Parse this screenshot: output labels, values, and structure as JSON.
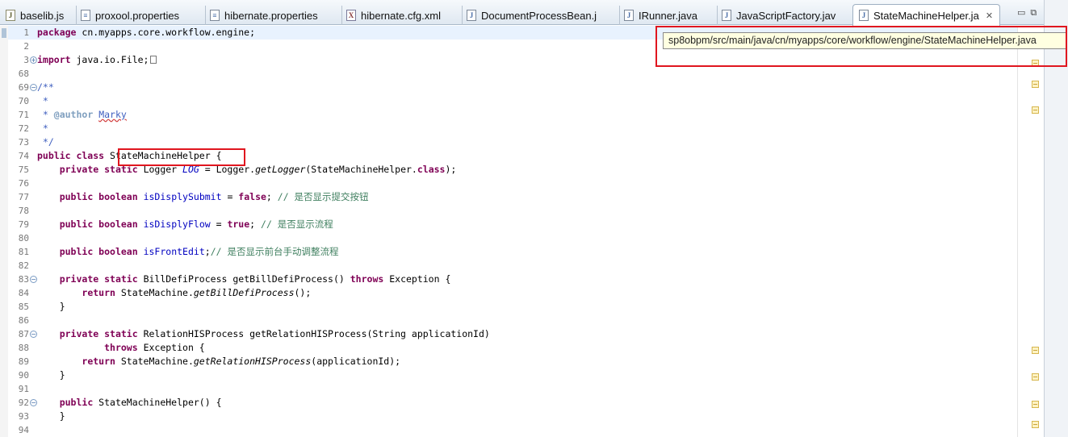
{
  "tabs": [
    {
      "label": "baselib.js",
      "icon": "js-file-icon"
    },
    {
      "label": "proxool.properties",
      "icon": "properties-file-icon"
    },
    {
      "label": "hibernate.properties",
      "icon": "properties-file-icon"
    },
    {
      "label": "hibernate.cfg.xml",
      "icon": "xml-file-icon"
    },
    {
      "label": "DocumentProcessBean.j",
      "icon": "java-file-icon"
    },
    {
      "label": "IRunner.java",
      "icon": "java-file-icon"
    },
    {
      "label": "JavaScriptFactory.jav",
      "icon": "java-file-icon"
    },
    {
      "label": "StateMachineHelper.ja",
      "icon": "java-file-icon",
      "active": true,
      "close": "✕"
    }
  ],
  "tooltip": {
    "path": "sp8obpm/src/main/java/cn/myapps/core/workflow/engine/StateMachineHelper.java"
  },
  "editor": {
    "line_numbers": [
      "1",
      "2",
      "3",
      "68",
      "69",
      "70",
      "71",
      "72",
      "73",
      "74",
      "75",
      "76",
      "77",
      "78",
      "79",
      "80",
      "81",
      "82",
      "83",
      "84",
      "85",
      "86",
      "87",
      "88",
      "89",
      "90",
      "91",
      "92",
      "93",
      "94"
    ],
    "code": {
      "pkg_kw": "package",
      "pkg_name": " cn.myapps.core.workflow.engine;",
      "import_kw": "import",
      "import_name": " java.io.File;",
      "jd_open": "/**",
      "jd_star": " *",
      "jd_author_prefix": " * ",
      "jd_author_tag": "@author",
      "jd_author_space": " ",
      "jd_author_name": "Marky",
      "jd_close": " */",
      "l74_kw": "public class",
      "l74_space": " ",
      "l74_name": "StateMachineHelper",
      "l74_brace": " {",
      "l75_indent": "    ",
      "l75_kw": "private static",
      "l75_type": " Logger ",
      "l75_field": "LOG",
      "l75_eq": " = Logger.",
      "l75_method": "getLogger",
      "l75_args": "(StateMachineHelper.",
      "l75_classkw": "class",
      "l75_end": ");",
      "l77_indent": "    ",
      "l77_kw": "public boolean",
      "l77_space": " ",
      "l77_field": "isDisplySubmit",
      "l77_eq": " = ",
      "l77_val": "false",
      "l77_semi": "; ",
      "l77_comment": "// 是否显示提交按钮",
      "l79_indent": "    ",
      "l79_kw": "public boolean",
      "l79_space": " ",
      "l79_field": "isDisplyFlow",
      "l79_eq": " = ",
      "l79_val": "true",
      "l79_semi": "; ",
      "l79_comment": "// 是否显示流程",
      "l81_indent": "    ",
      "l81_kw": "public boolean",
      "l81_space": " ",
      "l81_field": "isFrontEdit",
      "l81_semi": ";",
      "l81_comment": "// 是否显示前台手动调整流程",
      "l83_indent": "    ",
      "l83_kw": "private static",
      "l83_sig": " BillDefiProcess getBillDefiProcess() ",
      "l83_throws": "throws",
      "l83_exc": " Exception {",
      "l84_indent": "        ",
      "l84_kw": "return",
      "l84_obj": " StateMachine.",
      "l84_method": "getBillDefiProcess",
      "l84_end": "();",
      "l85_text": "    }",
      "l87_indent": "    ",
      "l87_kw": "private static",
      "l87_sig": " RelationHISProcess getRelationHISProcess(String applicationId)",
      "l88_indent": "            ",
      "l88_throws": "throws",
      "l88_exc": " Exception {",
      "l89_indent": "        ",
      "l89_kw": "return",
      "l89_obj": " StateMachine.",
      "l89_method": "getRelationHISProcess",
      "l89_end": "(applicationId);",
      "l90_text": "    }",
      "l92_indent": "    ",
      "l92_kw": "public",
      "l92_sig": " StateMachineHelper() {",
      "l93_text": "    }"
    }
  }
}
